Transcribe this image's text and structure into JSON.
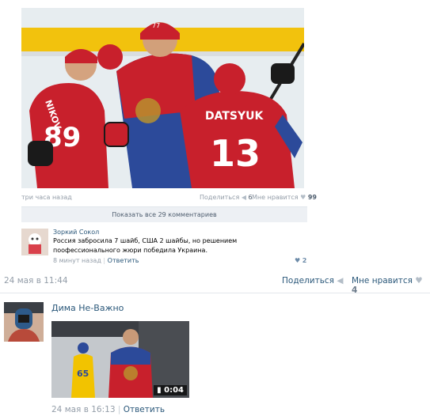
{
  "post1": {
    "photo_caption_time": "три часа назад",
    "share_label": "Поделиться",
    "share_count": "6",
    "like_label": "Мне нравится",
    "like_count": "99",
    "jersey_name": "DATSYUK",
    "jersey_number": "13",
    "jersey_number_left": "89",
    "jersey_name_left": "NIKOV",
    "jersey_number_center": "77"
  },
  "comments": {
    "show_all": "Показать все 29 комментариев",
    "author": "Зоркий Сокол",
    "text": "Россия забросила 7 шайб, США 2 шайбы, но решением поофессионального жюри победила Украина.",
    "time": "8 минут назад",
    "reply": "Ответить",
    "likes": "2"
  },
  "post_footer": {
    "date": "24 мая в 11:44",
    "share_label": "Поделиться",
    "like_label": "Мне нравится",
    "like_count": "4"
  },
  "post2": {
    "author": "Дима Не-Важно",
    "video_duration": "0:04",
    "video_number": "65",
    "date": "24 мая в 16:13",
    "reply": "Ответить"
  },
  "colors": {
    "link": "#2b587a",
    "muted": "#939da8",
    "jersey_red": "#c8202c",
    "jersey_blue": "#2c4a9a"
  },
  "icons": [
    "megaphone-icon",
    "heart-icon",
    "video-icon"
  ]
}
